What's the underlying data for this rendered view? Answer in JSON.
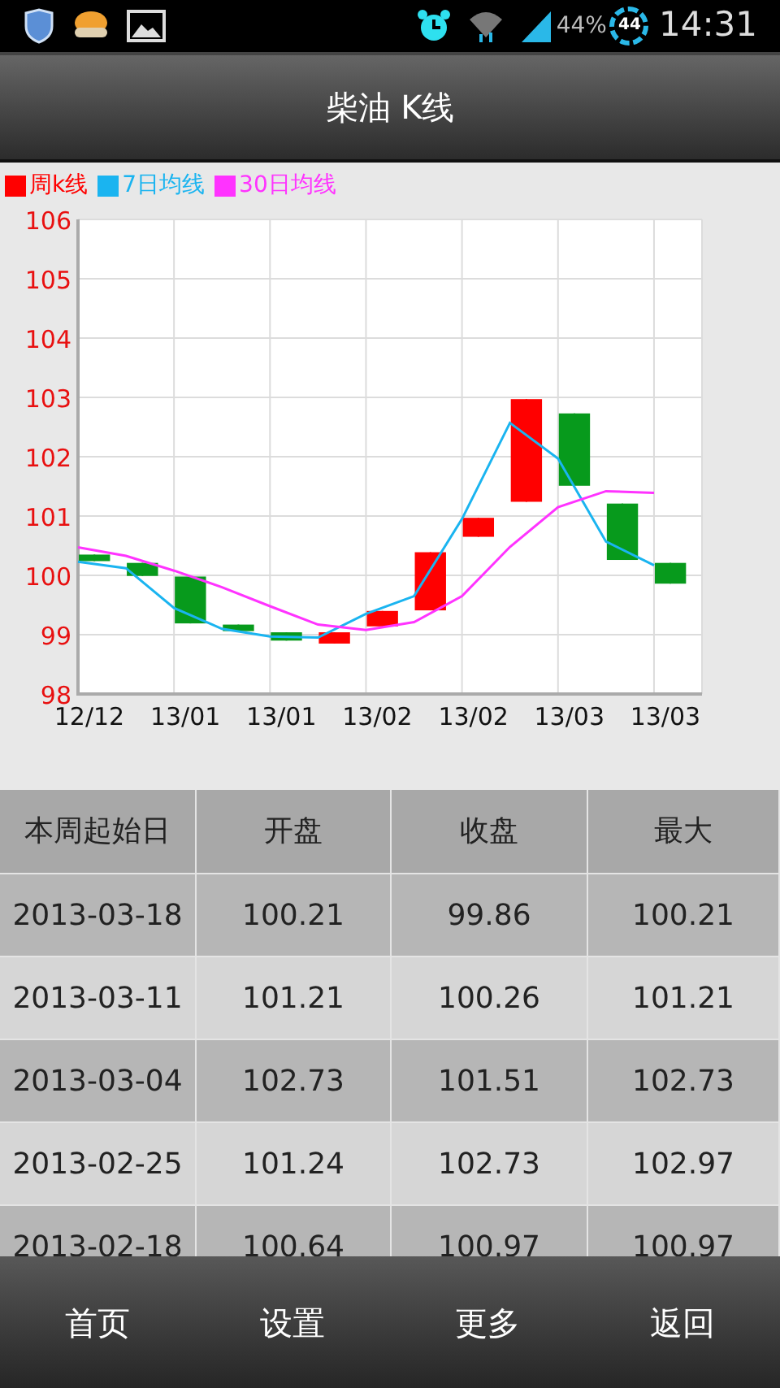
{
  "status_bar": {
    "battery_text": "44%",
    "battery_ring": "44",
    "time": "14:31"
  },
  "title": "柴油 K线",
  "chart_data": {
    "type": "line",
    "ylim": [
      98,
      106
    ],
    "yticks": [
      98,
      99,
      100,
      101,
      102,
      103,
      104,
      105,
      106
    ],
    "grid": true,
    "categories": [
      "12/12",
      null,
      "13/01",
      null,
      "13/01",
      null,
      "13/02",
      null,
      "13/02",
      null,
      "13/03",
      null,
      "13/03"
    ],
    "series": [
      {
        "name": "周k线",
        "color": "#ff0000",
        "type": "candlestick",
        "ohlc": [
          null,
          null,
          null,
          null,
          null,
          [
            98.85,
            99.04,
            98.85,
            99.04
          ],
          [
            99.14,
            99.4,
            99.14,
            99.4
          ],
          [
            99.41,
            100.39,
            99.41,
            100.39
          ],
          [
            100.65,
            100.97,
            100.65,
            100.97
          ],
          [
            101.24,
            102.97,
            101.24,
            102.97
          ],
          null,
          null,
          null
        ]
      },
      {
        "color": "#079a1c",
        "type": "candlestick",
        "ohlc": [
          [
            100.35,
            100.35,
            100.24,
            100.24
          ],
          [
            100.21,
            100.21,
            99.99,
            99.99
          ],
          [
            99.98,
            99.98,
            99.19,
            99.19
          ],
          [
            99.17,
            99.17,
            99.06,
            99.06
          ],
          [
            99.04,
            99.04,
            98.9,
            98.9
          ],
          null,
          null,
          null,
          null,
          null,
          [
            102.73,
            102.73,
            101.51,
            101.51
          ],
          [
            101.21,
            101.21,
            100.26,
            100.26
          ],
          [
            100.21,
            100.21,
            99.86,
            99.86
          ]
        ]
      },
      {
        "name": "7日均线",
        "color": "#1ab4f0",
        "values": [
          100.23,
          100.12,
          99.45,
          99.1,
          98.97,
          98.95,
          99.35,
          99.65,
          100.95,
          102.57,
          101.97,
          100.57,
          100.17
        ]
      },
      {
        "name": "30日均线",
        "color": "#ff33ff",
        "values": [
          100.47,
          100.33,
          100.08,
          99.8,
          99.48,
          99.17,
          99.08,
          99.21,
          99.65,
          100.48,
          101.15,
          101.42,
          101.39
        ]
      }
    ]
  },
  "table": {
    "columns": [
      "本周起始日",
      "开盘",
      "收盘",
      "最大"
    ],
    "rows": [
      [
        "2013-03-18",
        "100.21",
        "99.86",
        "100.21"
      ],
      [
        "2013-03-11",
        "101.21",
        "100.26",
        "101.21"
      ],
      [
        "2013-03-04",
        "102.73",
        "101.51",
        "102.73"
      ],
      [
        "2013-02-25",
        "101.24",
        "102.73",
        "102.97"
      ],
      [
        "2013-02-18",
        "100.64",
        "100.97",
        "100.97"
      ]
    ]
  },
  "bottom_nav": [
    "首页",
    "设置",
    "更多",
    "返回"
  ]
}
